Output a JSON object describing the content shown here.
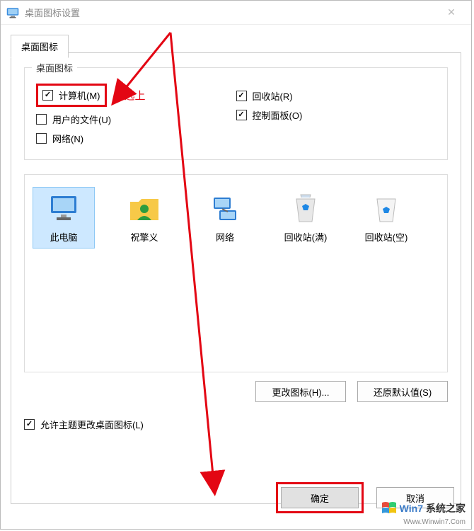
{
  "window": {
    "title": "桌面图标设置"
  },
  "tab": {
    "label": "桌面图标"
  },
  "group": {
    "legend": "桌面图标"
  },
  "checkboxes": {
    "computer": {
      "label": "计算机(M)",
      "checked": true
    },
    "userfiles": {
      "label": "用户的文件(U)",
      "checked": false
    },
    "network": {
      "label": "网络(N)",
      "checked": false
    },
    "recycle": {
      "label": "回收站(R)",
      "checked": true
    },
    "control": {
      "label": "控制面板(O)",
      "checked": true
    }
  },
  "annotation": {
    "check_hint": "勾选上"
  },
  "icons": {
    "thispc": {
      "label": "此电脑"
    },
    "user": {
      "label": "祝擎义"
    },
    "network": {
      "label": "网络"
    },
    "recycle_full": {
      "label": "回收站(满)"
    },
    "recycle_empty": {
      "label": "回收站(空)"
    }
  },
  "buttons": {
    "change_icon": "更改图标(H)...",
    "restore": "还原默认值(S)",
    "ok": "确定",
    "cancel": "取消"
  },
  "allow_theme": {
    "label": "允许主题更改桌面图标(L)",
    "checked": true
  },
  "watermark": {
    "brand1": "Win7",
    "brand2": "系统之家",
    "url": "Www.Winwin7.Com"
  }
}
